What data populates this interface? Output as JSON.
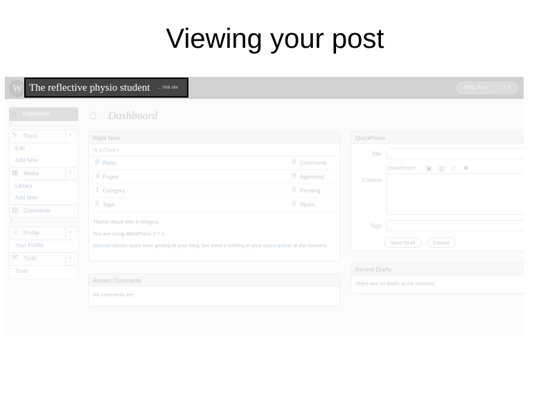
{
  "slide": {
    "title": "Viewing your post"
  },
  "admin_header": {
    "logo_icon": "wordpress-logo-icon",
    "site_title": "The reflective physio student",
    "visit_site": "← Visit site",
    "new_post_button": "New Post",
    "new_post_arrow": "▾"
  },
  "sidebar": {
    "dashboard": {
      "icon": "⌂",
      "label": "Dashboard"
    },
    "separator_arrow": "«",
    "groups": [
      {
        "icon": "✎",
        "label": "Posts",
        "arrow": "▾",
        "items": [
          "Edit",
          "Add New"
        ]
      },
      {
        "icon": "▦",
        "label": "Media",
        "arrow": "▾",
        "items": [
          "Library",
          "Add New"
        ]
      }
    ],
    "comments": {
      "icon": "▤",
      "label": "Comments"
    },
    "groups2": [
      {
        "icon": "☺",
        "label": "Profile",
        "arrow": "▾",
        "items": [
          "Your Profile"
        ]
      },
      {
        "icon": "⚒",
        "label": "Tools",
        "arrow": "▾",
        "items": [
          "Tools"
        ]
      }
    ]
  },
  "page": {
    "icon": "⌂",
    "title": "Dashboard"
  },
  "right_now": {
    "title": "Right Now",
    "subtitle": "At a Glance",
    "rows": [
      {
        "count": "0",
        "label": "Posts",
        "count2": "0",
        "label2": "Comments"
      },
      {
        "count": "4",
        "label": "Pages",
        "count2": "0",
        "label2": "Approved"
      },
      {
        "count": "1",
        "label": "Category",
        "count2": "0",
        "label2": "Pending"
      },
      {
        "count": "0",
        "label": "Tags",
        "count2": "0",
        "label2": "Spam"
      }
    ],
    "theme_line": "Theme iNove with 5 Widgets",
    "version_line": "You are using WordPress 2.7.1",
    "akismet_link": "Akismet",
    "akismet_text": " blocks spam from getting to your blog, but there's nothing in your ",
    "spam_queue_link": "spam queue",
    "akismet_tail": " at the moment."
  },
  "recent_comments": {
    "title": "Recent Comments",
    "body": "No comments yet."
  },
  "quickpress": {
    "title": "QuickPress",
    "title_label": "Title",
    "title_value": "",
    "upload_insert": "Upload/Insert",
    "content_label": "Content",
    "content_value": "",
    "tags_label": "Tags",
    "tags_value": "",
    "save_draft": "Save Draft",
    "cancel": "Cancel",
    "icons": {
      "image": "▣",
      "video": "▥",
      "audio": "♫",
      "media": "✺"
    }
  },
  "recent_drafts": {
    "title": "Recent Drafts",
    "body": "There are no drafts at the moment."
  }
}
